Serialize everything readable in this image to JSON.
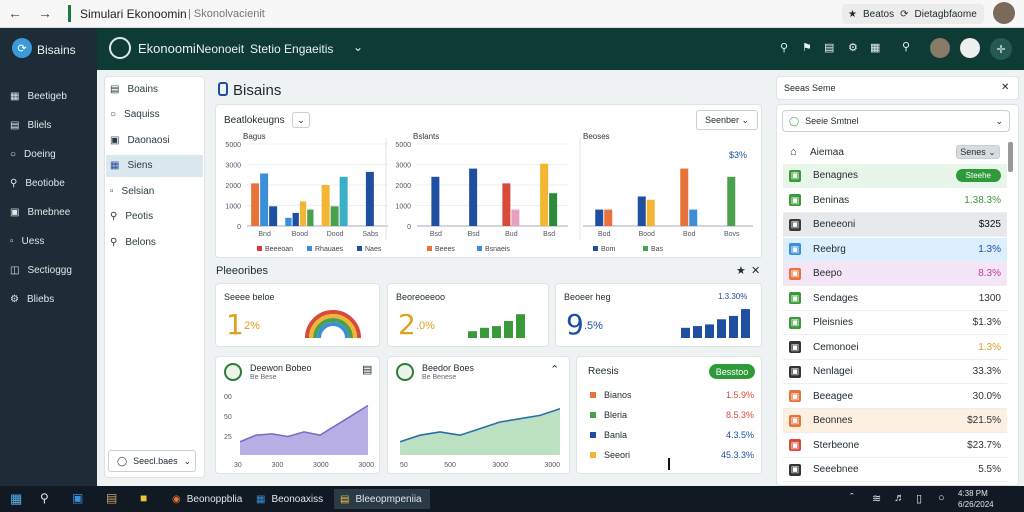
{
  "browser": {
    "title": "Simulari Ekonoomin",
    "subtitle": "| Skonolvacienit",
    "pill_left": "Beatos",
    "pill_right": "Dietagbfaome"
  },
  "app": {
    "brand": "Bisains",
    "title": "Ekonoomi",
    "menu1": "Neonoeit",
    "menu2": "Stetio Engaeitis"
  },
  "leftnav": [
    "Beetigeb",
    "Bliels",
    "Doeing",
    "Beotiobe",
    "Bmebnee",
    "Uess",
    "Sectioggg",
    "Bliebs"
  ],
  "sidebar": {
    "items": [
      "Boains",
      "Saquiss",
      "Daonaosi",
      "Siens",
      "Selsian",
      "Peotis",
      "Belons"
    ],
    "footer": "Seecl.baes"
  },
  "main": {
    "heading": "Bisains",
    "chart_selector": "Beatlokeugns",
    "chart_dropdown": "Seenber",
    "predictions_title": "Pleeoribes"
  },
  "chart_data": [
    {
      "type": "bar",
      "title": "Bagus",
      "yticks": [
        "5000",
        "3000",
        "2000",
        "1000",
        "0"
      ],
      "categories": [
        "Bnd",
        "Bood",
        "Dood",
        "Sabs"
      ],
      "series": [
        {
          "color": "#e8733a",
          "values": [
            2600,
            0,
            0,
            0
          ]
        },
        {
          "color": "#3a8fd8",
          "values": [
            3200,
            500,
            0,
            0
          ]
        },
        {
          "color": "#1e4fa0",
          "values": [
            1200,
            800,
            0,
            3300
          ]
        },
        {
          "color": "#f2b534",
          "values": [
            0,
            1500,
            2500,
            0
          ]
        },
        {
          "color": "#4aa04c",
          "values": [
            0,
            1000,
            1200,
            0
          ]
        },
        {
          "color": "#3ab0c8",
          "values": [
            0,
            0,
            3000,
            0
          ]
        }
      ],
      "legend": [
        {
          "label": "Beeeoan",
          "color": "#d83a3a"
        },
        {
          "label": "Rhauaes",
          "color": "#3a8fd8"
        },
        {
          "label": "Naes",
          "color": "#1e4fa0"
        }
      ]
    },
    {
      "type": "bar",
      "title": "Bslants",
      "yticks": [
        "5000",
        "3000",
        "2000",
        "1000",
        "0"
      ],
      "categories": [
        "Bsd",
        "Bsd",
        "Bud",
        "Bsd"
      ],
      "series": [
        {
          "color": "#1e4fa0",
          "values": [
            3000,
            3500,
            0,
            0
          ]
        },
        {
          "color": "#d84a3a",
          "values": [
            0,
            0,
            2600,
            0
          ]
        },
        {
          "color": "#e8a0c0",
          "values": [
            0,
            0,
            1000,
            0
          ]
        },
        {
          "color": "#f2b534",
          "values": [
            0,
            0,
            0,
            3800
          ]
        },
        {
          "color": "#2d8a3a",
          "values": [
            0,
            0,
            0,
            2000
          ]
        }
      ],
      "legend": [
        {
          "label": "Beees",
          "color": "#e8733a"
        },
        {
          "label": "Bsnaeis",
          "color": "#3a8fd8"
        }
      ]
    },
    {
      "type": "bar",
      "title": "Beoses",
      "annotation": "$3%",
      "categories": [
        "Bod",
        "Bood",
        "Bod",
        "Bovs"
      ],
      "series": [
        {
          "color": "#1e4fa0",
          "values": [
            1000,
            1800,
            0,
            0
          ]
        },
        {
          "color": "#e8733a",
          "values": [
            1000,
            0,
            3500,
            0
          ]
        },
        {
          "color": "#f2b534",
          "values": [
            0,
            1600,
            0,
            0
          ]
        },
        {
          "color": "#3a8fd8",
          "values": [
            0,
            0,
            1000,
            0
          ]
        },
        {
          "color": "#4aa04c",
          "values": [
            0,
            0,
            0,
            3000
          ]
        }
      ],
      "legend": [
        {
          "label": "Bom",
          "color": "#1e4fa0"
        },
        {
          "label": "Bas",
          "color": "#4aa04c"
        }
      ]
    }
  ],
  "kpis": [
    {
      "title": "Seeee beloe",
      "value": "1",
      "unit": "2%",
      "color": "#e0a020"
    },
    {
      "title": "Beoreoeeoo",
      "value": "2",
      "unit": ".0%",
      "color": "#e0a020"
    },
    {
      "title": "Beoeer heg",
      "value": "9",
      "unit": ".5%",
      "color": "#1e4fa0",
      "badge": "1.3.30%"
    }
  ],
  "kpi_bars": [
    {
      "color": "#3a9a3a",
      "values": [
        0.25,
        0.3,
        0.4,
        0.55,
        0.7,
        0.85
      ]
    },
    {
      "color": "#3a9a3a",
      "values": [
        0.2,
        0.3,
        0.35,
        0.5,
        0.7
      ]
    },
    {
      "color": "#1e4fa0",
      "values": [
        0.3,
        0.35,
        0.4,
        0.55,
        0.65,
        0.85
      ]
    }
  ],
  "areacards": [
    {
      "title": "Deewon Bobeo",
      "sub": "Be Bese",
      "xticks": [
        "30",
        "300",
        "3000",
        "3000"
      ],
      "yticks": [
        "00",
        "50",
        "25"
      ]
    },
    {
      "title": "Beedor Boes",
      "sub": "Be Benese",
      "xticks": [
        "50",
        "500",
        "3000",
        "3000"
      ]
    }
  ],
  "area_series": [
    {
      "color": "#7a6cc8",
      "fill": "#9a8fd8",
      "points": [
        0.2,
        0.3,
        0.32,
        0.28,
        0.35,
        0.3,
        0.45,
        0.6,
        0.75
      ]
    },
    {
      "color": "#2a70a8",
      "fill": "#9ed3a8",
      "points": [
        0.2,
        0.3,
        0.35,
        0.3,
        0.4,
        0.5,
        0.55,
        0.6,
        0.7
      ]
    }
  ],
  "results": {
    "title": "Reesis",
    "button": "Besstoo",
    "rows": [
      {
        "label": "Bianos",
        "value": "1.5.9%",
        "color": "#e8733a",
        "valcolor": "#d84a3a"
      },
      {
        "label": "Bleria",
        "value": "8.5.3%",
        "color": "#4aa04c",
        "valcolor": "#d84a3a"
      },
      {
        "label": "Banla",
        "value": "4.3.5%",
        "color": "#1e4fa0",
        "valcolor": "#1e4fa0"
      },
      {
        "label": "Seeori",
        "value": "45.3.3%",
        "color": "#f2b534",
        "valcolor": "#1e4fa0"
      }
    ]
  },
  "rightpanel": {
    "title": "Seeas Seme",
    "search": "Seeie Smtnel",
    "section": "Aiemaa",
    "section_btn": "Senes",
    "rows": [
      {
        "label": "Benagnes",
        "value": "Steehe",
        "icolor": "#3a9a3a",
        "bg": "#e8f6ea",
        "pill": true
      },
      {
        "label": "Beninas",
        "value": "1.38.3%",
        "icolor": "#3a9a3a",
        "bg": "#ffffff",
        "valcolor": "#3a9a3a"
      },
      {
        "label": "Beneeoni",
        "value": "$325",
        "icolor": "#3a3a3a",
        "bg": "#e6e8ea",
        "valcolor": "#111111"
      },
      {
        "label": "Reebrg",
        "value": "1.3%",
        "icolor": "#3a8fd8",
        "bg": "#dcefff",
        "valcolor": "#1e4fa0"
      },
      {
        "label": "Beepo",
        "value": "8.3%",
        "icolor": "#e8733a",
        "bg": "#f4e6f6",
        "valcolor": "#c03aa0"
      },
      {
        "label": "Sendages",
        "value": "1300",
        "icolor": "#3a9a3a",
        "bg": "#ffffff",
        "valcolor": "#333333"
      },
      {
        "label": "Pleisnies",
        "value": "$1.3%",
        "icolor": "#3a9a3a",
        "bg": "#ffffff",
        "valcolor": "#333333"
      },
      {
        "label": "Cemonoei",
        "value": "1.3%",
        "icolor": "#333333",
        "bg": "#ffffff",
        "valcolor": "#e0a020"
      },
      {
        "label": "Nenlagei",
        "value": "33.3%",
        "icolor": "#333333",
        "bg": "#ffffff",
        "valcolor": "#333333"
      },
      {
        "label": "Beeagee",
        "value": "30.0%",
        "icolor": "#e8733a",
        "bg": "#ffffff",
        "valcolor": "#333333"
      },
      {
        "label": "Beonnes",
        "value": "$21.5%",
        "icolor": "#e8733a",
        "bg": "#fdf0e0",
        "valcolor": "#333333"
      },
      {
        "label": "Sterbeone",
        "value": "$23.7%",
        "icolor": "#d84a3a",
        "bg": "#ffffff",
        "valcolor": "#333333"
      },
      {
        "label": "Seeebnee",
        "value": "5.5%",
        "icolor": "#333333",
        "bg": "#ffffff",
        "valcolor": "#333333"
      }
    ]
  },
  "taskbar": {
    "apps": [
      "Beonoppblia",
      "Beonoaxiss",
      "Bleeopmpeniia"
    ],
    "time": "4:38 PM",
    "date": "6/26/2024"
  }
}
